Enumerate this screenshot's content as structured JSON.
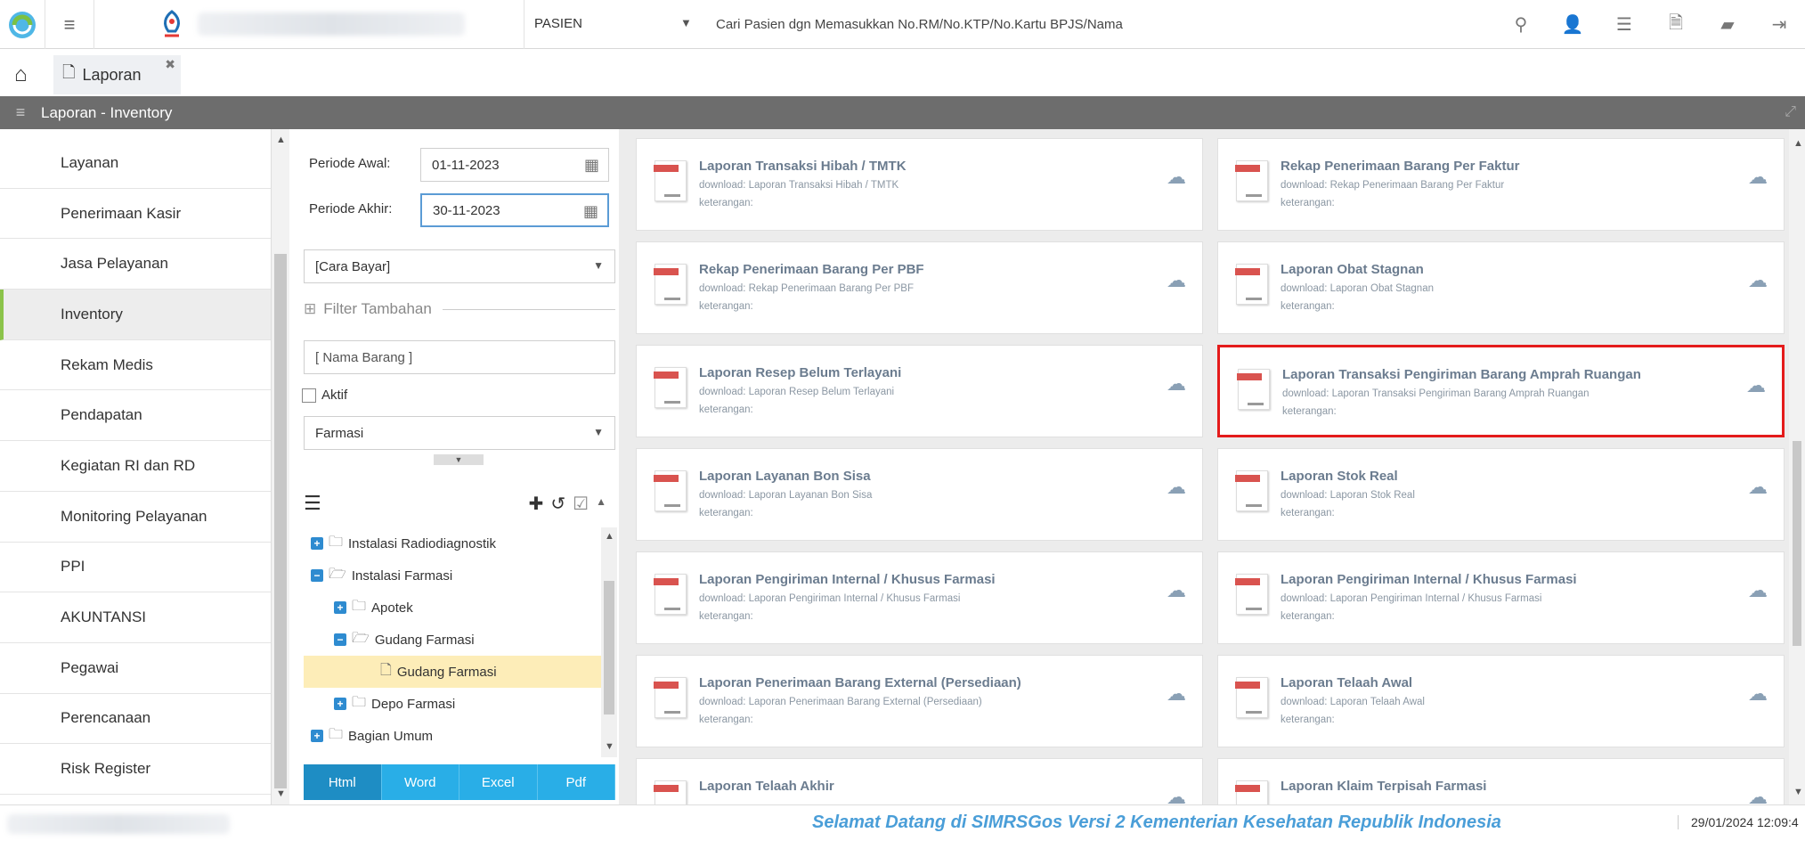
{
  "topbar": {
    "module_label": "PASIEN",
    "search_placeholder": "Cari Pasien dgn Memasukkan No.RM/No.KTP/No.Kartu BPJS/Nama",
    "icons": [
      "search-icon",
      "add-user-icon",
      "list-icon",
      "pdf-icon",
      "folder-icon",
      "logout-icon"
    ]
  },
  "tabs": [
    {
      "label": "Laporan"
    }
  ],
  "title": "Laporan - Inventory",
  "sidebar": {
    "items": [
      {
        "label": "Layanan"
      },
      {
        "label": "Penerimaan Kasir"
      },
      {
        "label": "Jasa Pelayanan"
      },
      {
        "label": "Inventory",
        "active": true
      },
      {
        "label": "Rekam Medis"
      },
      {
        "label": "Pendapatan"
      },
      {
        "label": "Kegiatan RI dan RD"
      },
      {
        "label": "Monitoring Pelayanan"
      },
      {
        "label": "PPI"
      },
      {
        "label": "AKUNTANSI"
      },
      {
        "label": "Pegawai"
      },
      {
        "label": "Perencanaan"
      },
      {
        "label": "Risk Register"
      }
    ]
  },
  "filter": {
    "periode_awal_label": "Periode Awal:",
    "periode_awal_value": "01-11-2023",
    "periode_akhir_label": "Periode Akhir:",
    "periode_akhir_value": "30-11-2023",
    "cara_bayar": "[Cara Bayar]",
    "filter_tambahan": "Filter Tambahan",
    "nama_barang_placeholder": "[ Nama Barang ]",
    "aktif_label": "Aktif",
    "unit_select": "Farmasi"
  },
  "tree": {
    "nodes": [
      {
        "label": "Instalasi Radiodiagnostik",
        "pm": "+",
        "level": 0
      },
      {
        "label": "Instalasi Farmasi",
        "pm": "−",
        "level": 0
      },
      {
        "label": "Apotek",
        "pm": "+",
        "level": 1
      },
      {
        "label": "Gudang Farmasi",
        "pm": "−",
        "level": 1
      },
      {
        "label": "Gudang Farmasi",
        "pm": "",
        "level": 2,
        "selected": true
      },
      {
        "label": "Depo Farmasi",
        "pm": "+",
        "level": 1
      },
      {
        "label": "Bagian Umum",
        "pm": "+",
        "level": 0
      }
    ]
  },
  "export_buttons": [
    {
      "label": "Html",
      "active": true
    },
    {
      "label": "Word"
    },
    {
      "label": "Excel"
    },
    {
      "label": "Pdf"
    }
  ],
  "reports": [
    {
      "title": "Laporan Transaksi Hibah / TMTK",
      "download": "download: Laporan Transaksi Hibah / TMTK",
      "note": "keterangan:"
    },
    {
      "title": "Rekap Penerimaan Barang Per Faktur",
      "download": "download: Rekap Penerimaan Barang Per Faktur",
      "note": "keterangan:"
    },
    {
      "title": "Rekap Penerimaan Barang Per PBF",
      "download": "download: Rekap Penerimaan Barang Per PBF",
      "note": "keterangan:"
    },
    {
      "title": "Laporan Obat Stagnan",
      "download": "download: Laporan Obat Stagnan",
      "note": "keterangan:"
    },
    {
      "title": "Laporan Resep Belum Terlayani",
      "download": "download: Laporan Resep Belum Terlayani",
      "note": "keterangan:"
    },
    {
      "title": "Laporan Transaksi Pengiriman Barang Amprah Ruangan",
      "download": "download: Laporan Transaksi Pengiriman Barang Amprah Ruangan",
      "note": "keterangan:",
      "highlighted": true
    },
    {
      "title": "Laporan Layanan Bon Sisa",
      "download": "download: Laporan Layanan Bon Sisa",
      "note": "keterangan:"
    },
    {
      "title": "Laporan Stok Real",
      "download": "download: Laporan Stok Real",
      "note": "keterangan:"
    },
    {
      "title": "Laporan Pengiriman Internal / Khusus Farmasi",
      "download": "download: Laporan Pengiriman Internal / Khusus Farmasi",
      "note": "keterangan:"
    },
    {
      "title": "Laporan Pengiriman Internal / Khusus Farmasi",
      "download": "download: Laporan Pengiriman Internal / Khusus Farmasi",
      "note": "keterangan:"
    },
    {
      "title": "Laporan Penerimaan Barang External (Persediaan)",
      "download": "download: Laporan Penerimaan Barang External (Persediaan)",
      "note": "keterangan:"
    },
    {
      "title": "Laporan Telaah Awal",
      "download": "download: Laporan Telaah Awal",
      "note": "keterangan:"
    },
    {
      "title": "Laporan Telaah Akhir",
      "download": "",
      "note": ""
    },
    {
      "title": "Laporan Klaim Terpisah Farmasi",
      "download": "",
      "note": ""
    }
  ],
  "footer": {
    "welcome": "Selamat Datang di SIMRSGos Versi 2 Kementerian Kesehatan Republik Indonesia",
    "timestamp": "29/01/2024 12:09:4"
  },
  "colors": {
    "accent": "#29aee7",
    "highlight_border": "#e41b1b",
    "active_marker": "#8bc34a"
  }
}
